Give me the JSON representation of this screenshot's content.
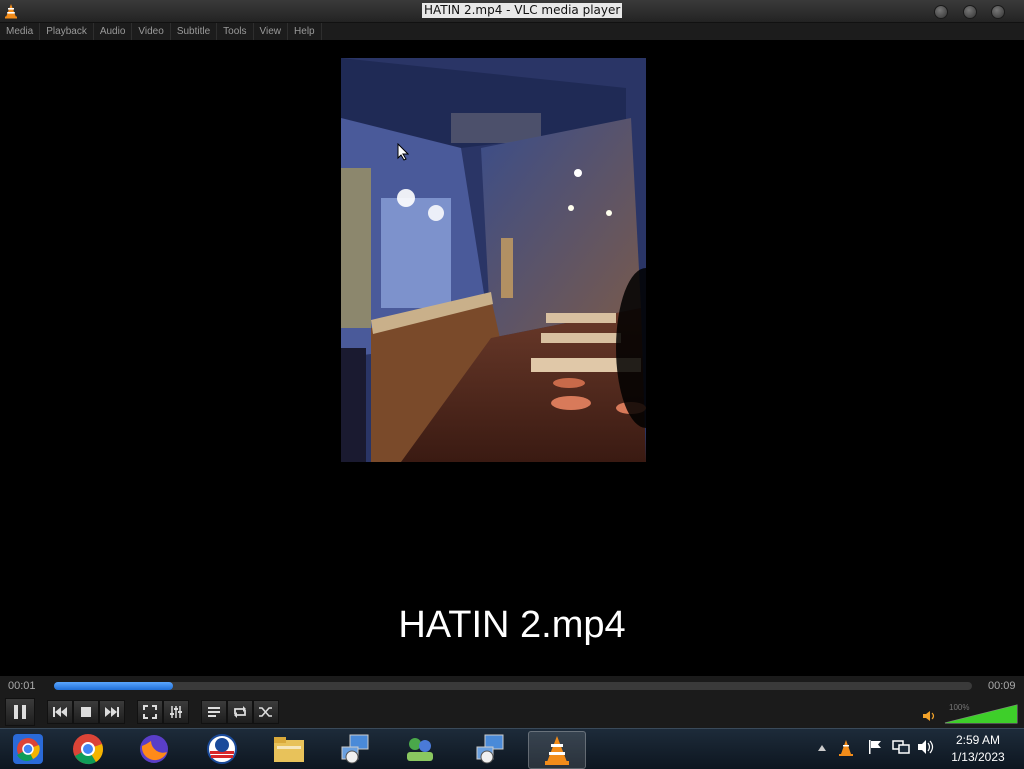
{
  "window": {
    "title": "HATIN 2.mp4 - VLC media player"
  },
  "menu": {
    "items": [
      "Media",
      "Playback",
      "Audio",
      "Video",
      "Subtitle",
      "Tools",
      "View",
      "Help"
    ]
  },
  "video": {
    "subtitle": "HATIN 2.mp4"
  },
  "controls": {
    "elapsed": "00:01",
    "total": "00:09",
    "progress_fraction": 0.13,
    "volume_label": "100%",
    "volume_fraction": 1.0,
    "accent_color": "#1f6fd8"
  },
  "taskbar": {
    "apps": [
      "chrome-icon",
      "chrome-icon",
      "firefox-icon",
      "obama-icon",
      "folder-icon",
      "network-tool-icon",
      "people-icon",
      "network-tool-icon",
      "vlc-icon"
    ]
  },
  "clock": {
    "time": "2:59 AM",
    "date": "1/13/2023"
  }
}
